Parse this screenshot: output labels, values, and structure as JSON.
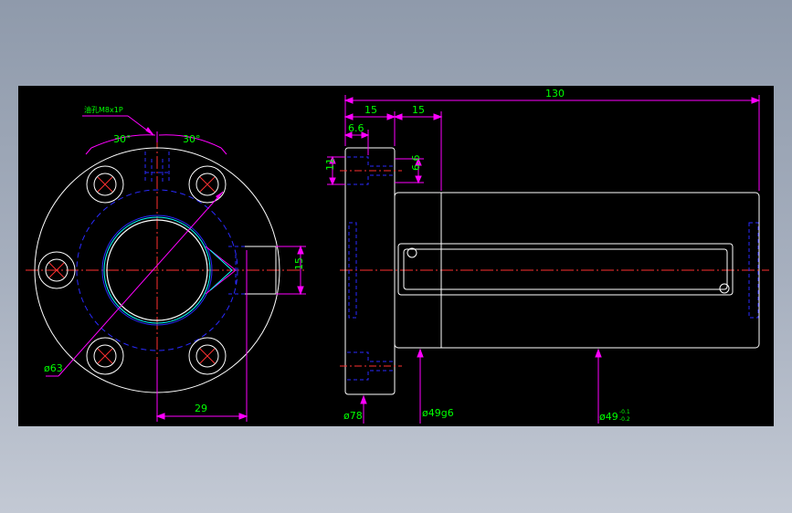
{
  "drawing": {
    "front_view": {
      "thread_note": "油孔M8x1P",
      "angle_left": "30°",
      "angle_right": "30°",
      "dia_bolt_circle": "ø63",
      "offset_width": "29",
      "boss_height": "15"
    },
    "side_view": {
      "overall_length": "130",
      "flange_thickness": "15",
      "neck_length": "15",
      "counterbore_depth": "6.6",
      "counterbore_dia": "11",
      "hole_depth": "6.6",
      "dia_flange": "ø78",
      "dia_body": "ø49g6",
      "dia_nut": "ø49",
      "dia_nut_tol_upper": "-0.1",
      "dia_nut_tol_lower": "-0.2"
    }
  },
  "colors": {
    "background": "#000000",
    "outline": "#ffffff",
    "dimension": "#ff00ff",
    "dimension_text": "#00ff00",
    "hidden": "#0000ff",
    "center": "#ff0000",
    "highlight": "#00ffff"
  }
}
